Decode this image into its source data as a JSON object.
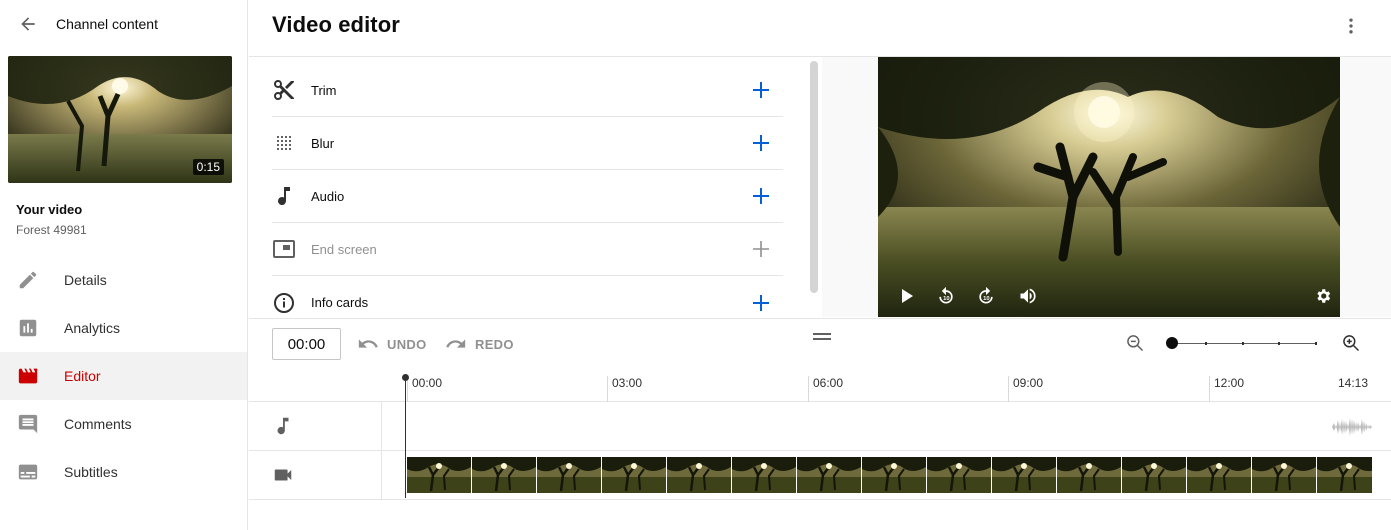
{
  "sidebar": {
    "title": "Channel content",
    "thumbnail": {
      "duration": "0:15"
    },
    "video_label": "Your video",
    "video_name": "Forest 49981",
    "nav": [
      {
        "label": "Details",
        "icon": "pencil-icon"
      },
      {
        "label": "Analytics",
        "icon": "analytics-icon"
      },
      {
        "label": "Editor",
        "icon": "clapperboard-icon",
        "active": true
      },
      {
        "label": "Comments",
        "icon": "comment-icon"
      },
      {
        "label": "Subtitles",
        "icon": "subtitles-icon"
      }
    ]
  },
  "header": {
    "title": "Video editor"
  },
  "tools": [
    {
      "label": "Trim",
      "icon": "scissors-icon"
    },
    {
      "label": "Blur",
      "icon": "blur-icon"
    },
    {
      "label": "Audio",
      "icon": "music-note-icon"
    },
    {
      "label": "End screen",
      "icon": "end-screen-icon",
      "disabled": true
    },
    {
      "label": "Info cards",
      "icon": "info-icon"
    }
  ],
  "timeline": {
    "timecode": "00:00",
    "undo_label": "UNDO",
    "redo_label": "REDO",
    "ruler": [
      "00:00",
      "03:00",
      "06:00",
      "09:00",
      "12:00",
      "14:13"
    ],
    "zoom_level": 0
  },
  "colors": {
    "accent": "#065fd4",
    "active_nav": "#cc0000",
    "disabled": "#909090"
  }
}
